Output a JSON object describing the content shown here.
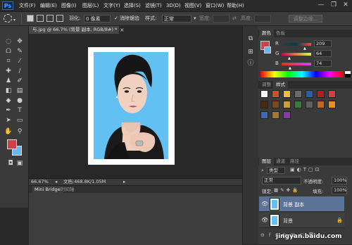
{
  "app": {
    "logo": "Ps"
  },
  "menu": [
    "文件(F)",
    "编辑(E)",
    "图像(I)",
    "图层(L)",
    "文字(Y)",
    "选择(S)",
    "滤镜(T)",
    "3D(D)",
    "视图(V)",
    "窗口(W)",
    "帮助(H)"
  ],
  "window_controls": {
    "minimize": "—",
    "restore": "❐",
    "close": "✕"
  },
  "options": {
    "feather_label": "羽化:",
    "feather_value": "0 像素",
    "antialias_label": "消除锯齿",
    "style_label": "样式:",
    "style_value": "正常",
    "width_label": "宽度:",
    "height_label": "高度:",
    "refine_button": "调整边缘..."
  },
  "document": {
    "tab_title": "与.jpg @ 66.7% (背景 副本, RGB/8#) *",
    "close": "×",
    "zoom": "66.67%",
    "doc_info": "文档:468.8K/1.05M"
  },
  "bottom_tabs": [
    "Mini Bridge",
    "时间轴"
  ],
  "color_panel": {
    "tabs": [
      "颜色",
      "色板"
    ],
    "channels": [
      {
        "label": "R",
        "value": "209"
      },
      {
        "label": "G",
        "value": "64"
      },
      {
        "label": "B",
        "value": "74"
      }
    ],
    "foreground_color": "#d1404a",
    "background_color": "#6fb6e8"
  },
  "styles_panel": {
    "tabs": [
      "调整",
      "样式"
    ],
    "swatch_colors": [
      "#ffffff",
      "#c8502a",
      "#e8c040",
      "#6a6a6a",
      "#2b5fa8",
      "#b02020",
      "#d04040",
      "#4a2a10",
      "#7b4a20",
      "#c8a040",
      "#3a7a3a",
      "#606060",
      "#c06820",
      "#e89020",
      "#3a6ab8",
      "#a87830",
      "#8a3aa8"
    ]
  },
  "layers_panel": {
    "tabs": [
      "图层",
      "通道",
      "路径"
    ],
    "kind_label": "类型",
    "blend_mode": "正常",
    "opacity_label": "不透明度:",
    "opacity_value": "100%",
    "lock_label": "锁定:",
    "fill_label": "填充:",
    "fill_value": "100%",
    "layers": [
      {
        "name": "背景 副本",
        "selected": true
      },
      {
        "name": "背景",
        "selected": false
      }
    ]
  },
  "watermark": "jingyan.baidu.com"
}
